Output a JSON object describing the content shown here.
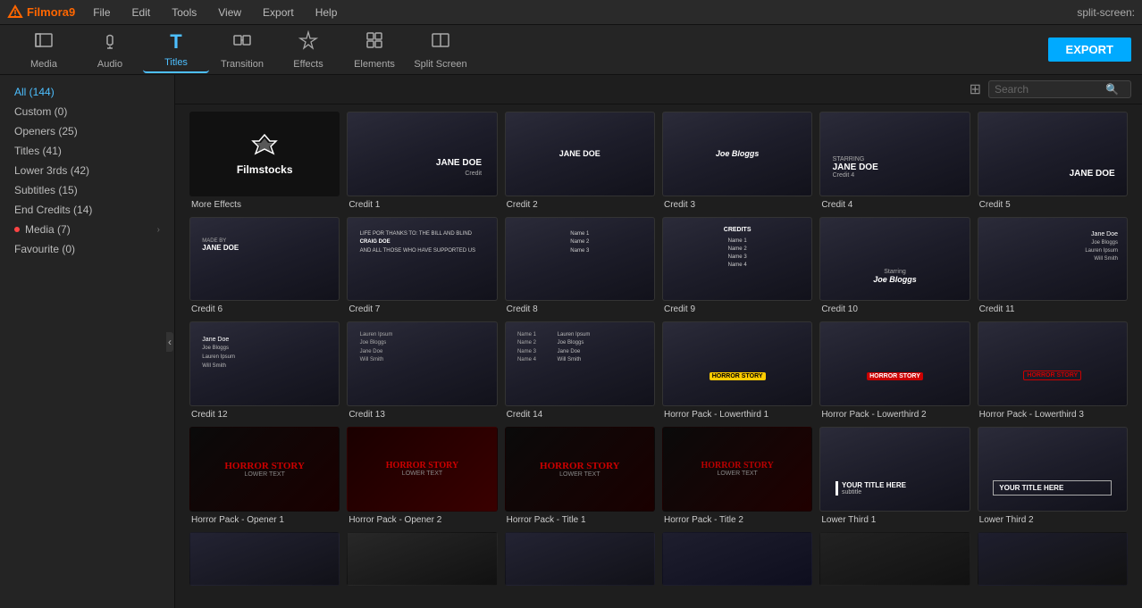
{
  "app": {
    "name": "Filmora9",
    "version": "9"
  },
  "menubar": {
    "items": [
      "File",
      "Edit",
      "Tools",
      "View",
      "Export",
      "Help"
    ],
    "right_label": "split-screen:"
  },
  "toolbar": {
    "items": [
      {
        "id": "media",
        "label": "Media",
        "icon": "🎬"
      },
      {
        "id": "audio",
        "label": "Audio",
        "icon": "🎵"
      },
      {
        "id": "titles",
        "label": "Titles",
        "icon": "T"
      },
      {
        "id": "transition",
        "label": "Transition",
        "icon": "↔"
      },
      {
        "id": "effects",
        "label": "Effects",
        "icon": "✦"
      },
      {
        "id": "elements",
        "label": "Elements",
        "icon": "◈"
      },
      {
        "id": "splitscreen",
        "label": "Split Screen",
        "icon": "⊞"
      }
    ],
    "active": "titles",
    "export_label": "EXPORT"
  },
  "sidebar": {
    "items": [
      {
        "label": "All (144)",
        "active": true,
        "dot": false
      },
      {
        "label": "Custom (0)",
        "active": false,
        "dot": false
      },
      {
        "label": "Openers (25)",
        "active": false,
        "dot": false
      },
      {
        "label": "Titles (41)",
        "active": false,
        "dot": false
      },
      {
        "label": "Lower 3rds (42)",
        "active": false,
        "dot": false
      },
      {
        "label": "Subtitles (15)",
        "active": false,
        "dot": false
      },
      {
        "label": "End Credits (14)",
        "active": false,
        "dot": false
      },
      {
        "label": "Media (7)",
        "active": false,
        "dot": true,
        "arrow": true
      },
      {
        "label": "Favourite (0)",
        "active": false,
        "dot": false
      }
    ]
  },
  "search": {
    "placeholder": "Search"
  },
  "grid": {
    "items": [
      {
        "id": "more-effects",
        "label": "More Effects",
        "type": "filmstocks"
      },
      {
        "id": "credit-1",
        "label": "Credit 1",
        "type": "credit-simple",
        "subtext": "JANE DOE"
      },
      {
        "id": "credit-2",
        "label": "Credit 2",
        "type": "credit-simple",
        "subtext": "JANE DOE"
      },
      {
        "id": "credit-3",
        "label": "Credit 3",
        "type": "credit-simple",
        "subtext": "Joe Bloggs"
      },
      {
        "id": "credit-4",
        "label": "Credit 4",
        "type": "credit-jane",
        "subtext": "JANE DOE"
      },
      {
        "id": "credit-5",
        "label": "Credit 5",
        "type": "credit-jane",
        "subtext": "JANE DOE"
      },
      {
        "id": "credit-6",
        "label": "Credit 6",
        "type": "credit-jane-small"
      },
      {
        "id": "credit-7",
        "label": "Credit 7",
        "type": "credit-lines"
      },
      {
        "id": "credit-8",
        "label": "Credit 8",
        "type": "credit-lines"
      },
      {
        "id": "credit-9",
        "label": "Credit 9",
        "type": "credit-lines"
      },
      {
        "id": "credit-10",
        "label": "Credit 10",
        "type": "credit-joe",
        "subtext": "Joe Bloggs"
      },
      {
        "id": "credit-11",
        "label": "Credit 11",
        "type": "credit-multi"
      },
      {
        "id": "credit-12",
        "label": "Credit 12",
        "type": "credit-scroll"
      },
      {
        "id": "credit-13",
        "label": "Credit 13",
        "type": "credit-scroll"
      },
      {
        "id": "credit-14",
        "label": "Credit 14",
        "type": "credit-scroll"
      },
      {
        "id": "horror-lower-1",
        "label": "Horror Pack - Lowerthird 1",
        "type": "horror-lower-yellow"
      },
      {
        "id": "horror-lower-2",
        "label": "Horror Pack - Lowerthird 2",
        "type": "horror-lower-red"
      },
      {
        "id": "horror-lower-3",
        "label": "Horror Pack - Lowerthird 3",
        "type": "horror-lower-outline"
      },
      {
        "id": "horror-opener-1",
        "label": "Horror Pack - Opener 1",
        "type": "horror-black-red"
      },
      {
        "id": "horror-opener-2",
        "label": "Horror Pack - Opener 2",
        "type": "horror-splash"
      },
      {
        "id": "horror-title-1",
        "label": "Horror Pack - Title 1",
        "type": "horror-dark"
      },
      {
        "id": "horror-title-2",
        "label": "Horror Pack - Title 2",
        "type": "horror-splash-2"
      },
      {
        "id": "lower-third-1",
        "label": "Lower Third 1",
        "type": "lower-third-bar"
      },
      {
        "id": "lower-third-2",
        "label": "Lower Third 2",
        "type": "lower-third-outline"
      },
      {
        "id": "more-1",
        "label": "",
        "type": "scene-dark"
      },
      {
        "id": "more-2",
        "label": "",
        "type": "scene-dark"
      },
      {
        "id": "more-3",
        "label": "",
        "type": "scene-dark"
      },
      {
        "id": "more-4",
        "label": "",
        "type": "scene-dark"
      },
      {
        "id": "more-5",
        "label": "",
        "type": "scene-dark"
      },
      {
        "id": "more-6",
        "label": "",
        "type": "scene-dark"
      }
    ]
  }
}
